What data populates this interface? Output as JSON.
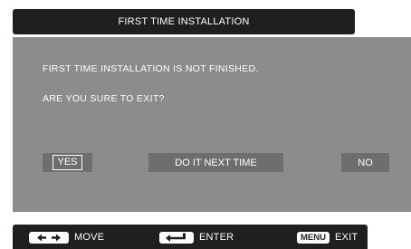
{
  "dialog": {
    "title": "FIRST TIME INSTALLATION",
    "message_line1": "FIRST TIME INSTALLATION IS NOT FINISHED.",
    "message_line2": "ARE YOU SURE TO EXIT?",
    "buttons": {
      "yes": "YES",
      "later": "DO IT NEXT TIME",
      "no": "NO"
    },
    "selected_button": "YES"
  },
  "help_bar": {
    "move": {
      "icon": "left-right-arrows-icon",
      "label": "MOVE"
    },
    "enter": {
      "icon": "enter-key-icon",
      "label": "ENTER"
    },
    "exit": {
      "key_label": "MENU",
      "label": "EXIT"
    }
  },
  "colors": {
    "title_bar": "#1f1f1f",
    "panel": "#8c8c8c",
    "button": "#6e6e6e",
    "text": "#ffffff"
  }
}
